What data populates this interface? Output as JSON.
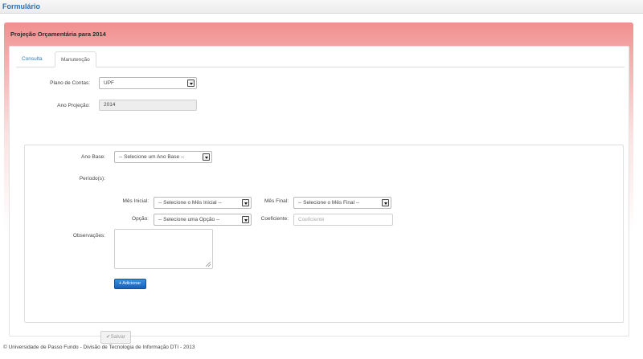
{
  "header": {
    "title": "Formulário"
  },
  "panel": {
    "title": "Projeção Orçamentária para 2014"
  },
  "tabs": [
    {
      "label": "Consulta"
    },
    {
      "label": "Manutenção"
    }
  ],
  "form": {
    "plano_label": "Plano de Contas:",
    "plano_value": "UPF",
    "ano_projecao_label": "Ano Projeção:",
    "ano_projecao_value": "2014",
    "ano_base_label": "Ano Base:",
    "ano_base_value": "-- Selecione um Ano Base --",
    "periodos_label": "Período(s):",
    "mes_inicial_label": "Mês Inicial:",
    "mes_inicial_value": "-- Selecione o Mês Inicial --",
    "mes_final_label": "Mês Final:",
    "mes_final_value": "-- Selecione o Mês Final --",
    "opcao_label": "Opção:",
    "opcao_value": "-- Selecione uma Opção --",
    "coeficiente_label": "Coeficiente:",
    "coeficiente_placeholder": "Coeficiente",
    "observacoes_label": "Observações:",
    "adicionar_label": "Adicionar",
    "salvar_label": "Salvar"
  },
  "footer": {
    "text": "© Universidade de Passo Fundo - Divisão de Tecnologia de Informação DTI - 2013"
  },
  "colors": {
    "link": "#2a7ab5",
    "primary_button": "#1860b8",
    "panel_header": "#f18f8f"
  },
  "icons": {
    "add": "plus-icon",
    "save": "checkmark-icon",
    "dropdown": "dropdown-arrow-icon"
  }
}
